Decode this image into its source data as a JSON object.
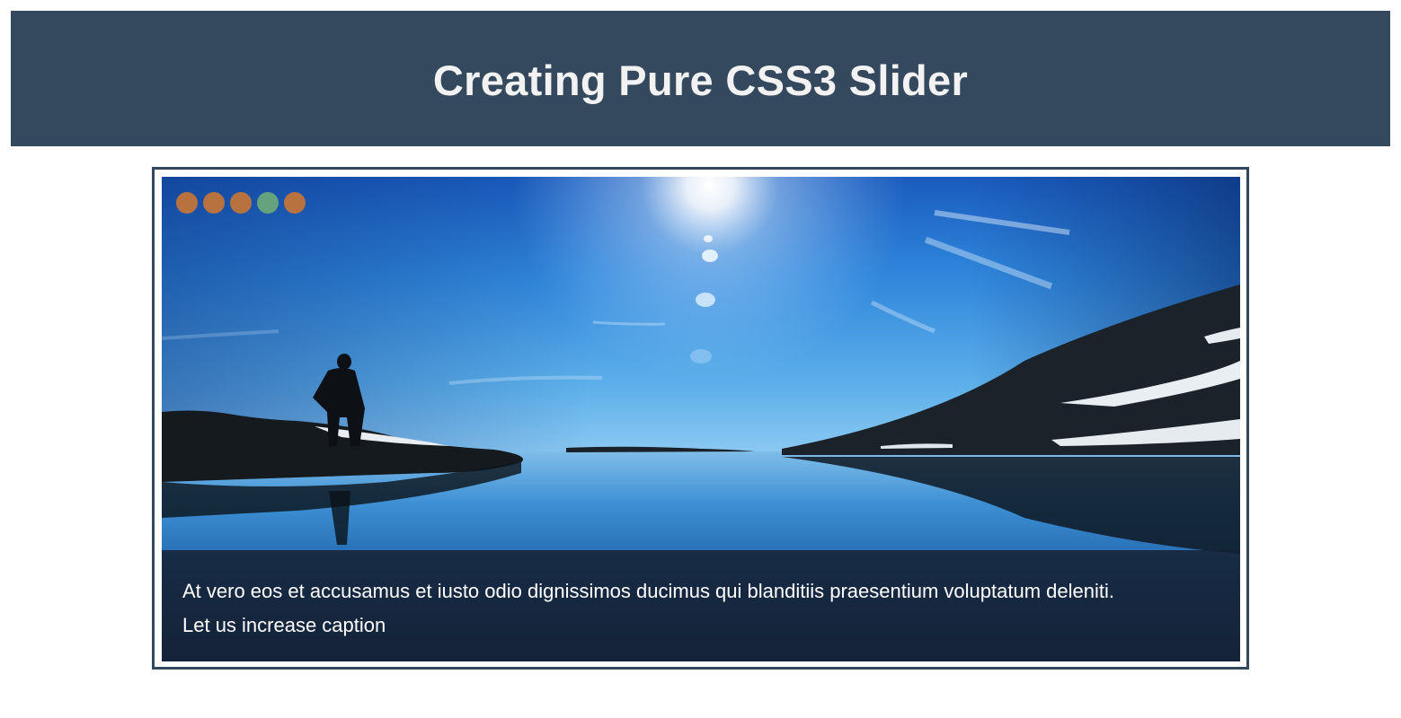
{
  "header": {
    "title": "Creating Pure CSS3 Slider",
    "background_color": "#34495e"
  },
  "slider": {
    "border_color": "#34495e",
    "image": {
      "description_icon": "landscape-photo"
    },
    "dots": [
      {
        "color": "#b87240",
        "active": false
      },
      {
        "color": "#b87240",
        "active": false
      },
      {
        "color": "#b87240",
        "active": false
      },
      {
        "color": "#64a37e",
        "active": true
      },
      {
        "color": "#b87240",
        "active": false
      }
    ],
    "caption": {
      "line1": "At vero eos et accusamus et iusto odio dignissimos ducimus qui blanditiis praesentium voluptatum deleniti.",
      "line2": "Let us increase caption"
    }
  }
}
